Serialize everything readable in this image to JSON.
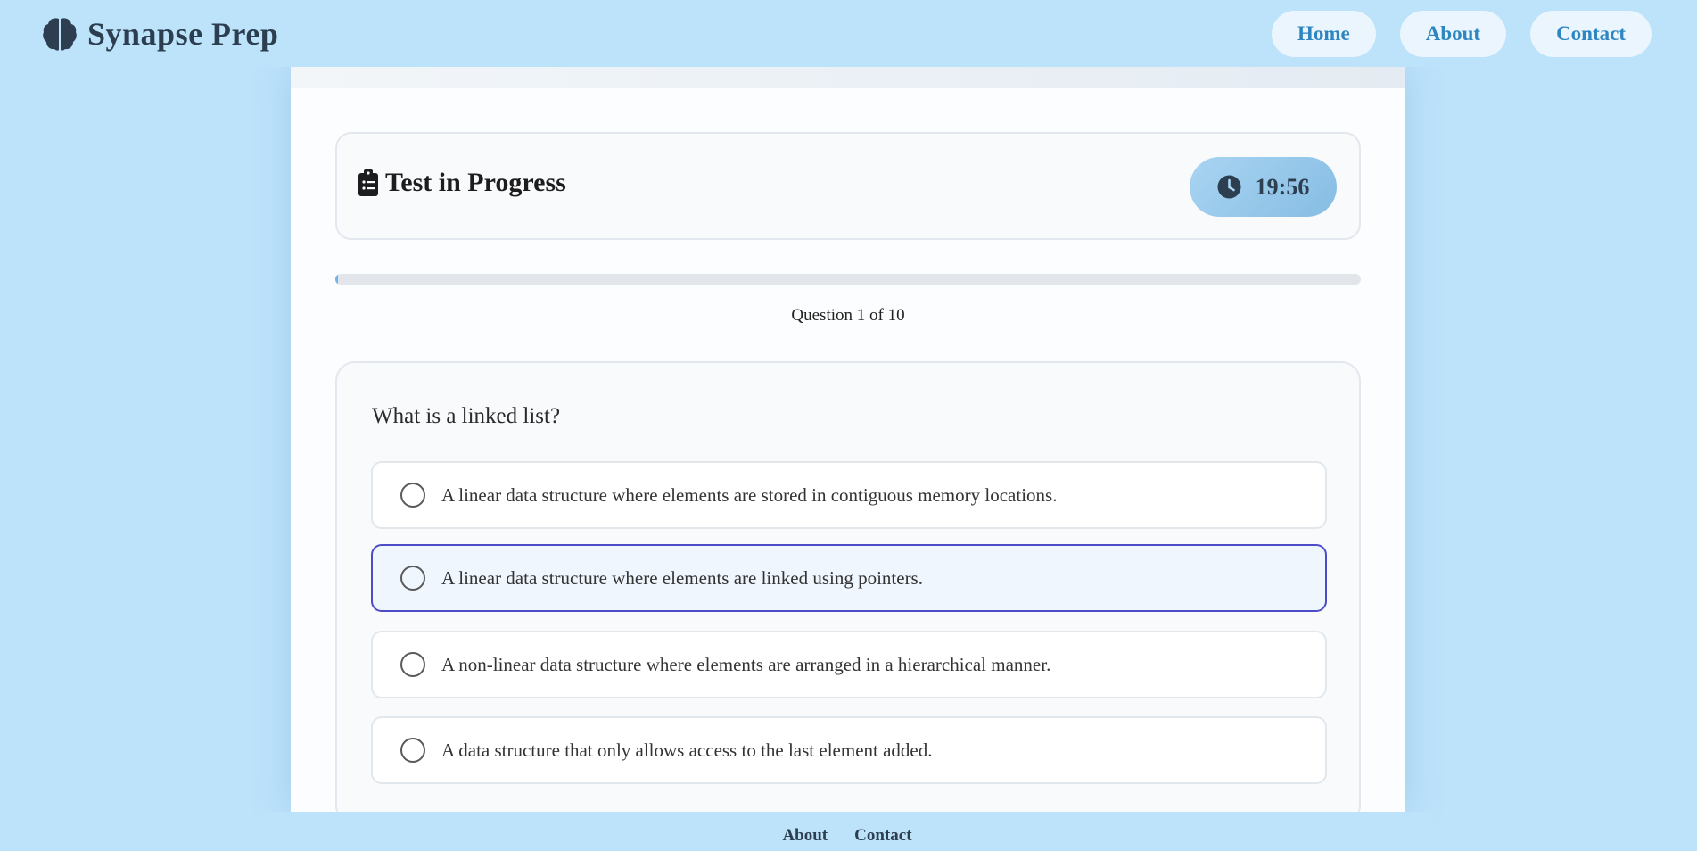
{
  "header": {
    "brand_icon": "brain-icon",
    "brand_title": "Synapse Prep",
    "nav": [
      {
        "label": "Home"
      },
      {
        "label": "About"
      },
      {
        "label": "Contact"
      }
    ]
  },
  "status": {
    "icon": "clipboard-list-icon",
    "title": "Test in Progress",
    "timer_icon": "clock-icon",
    "timer": "19:56"
  },
  "progress": {
    "fraction": 0.003
  },
  "question_counter": "Question 1 of 10",
  "question": {
    "text": "What is a linked list?",
    "options": [
      {
        "label": "A linear data structure where elements are stored in contiguous memory locations.",
        "selected": false
      },
      {
        "label": "A linear data structure where elements are linked using pointers.",
        "selected": true
      },
      {
        "label": "A non-linear data structure where elements are arranged in a hierarchical manner.",
        "selected": false
      },
      {
        "label": "A data structure that only allows access to the last element added.",
        "selected": false
      }
    ]
  },
  "footer": {
    "links": [
      {
        "label": "About"
      },
      {
        "label": "Contact"
      }
    ]
  },
  "colors": {
    "background": "#bde3fb",
    "accent": "#2e86c1",
    "selected_border": "#4d4bc7",
    "selected_bg": "#eff6fe"
  }
}
